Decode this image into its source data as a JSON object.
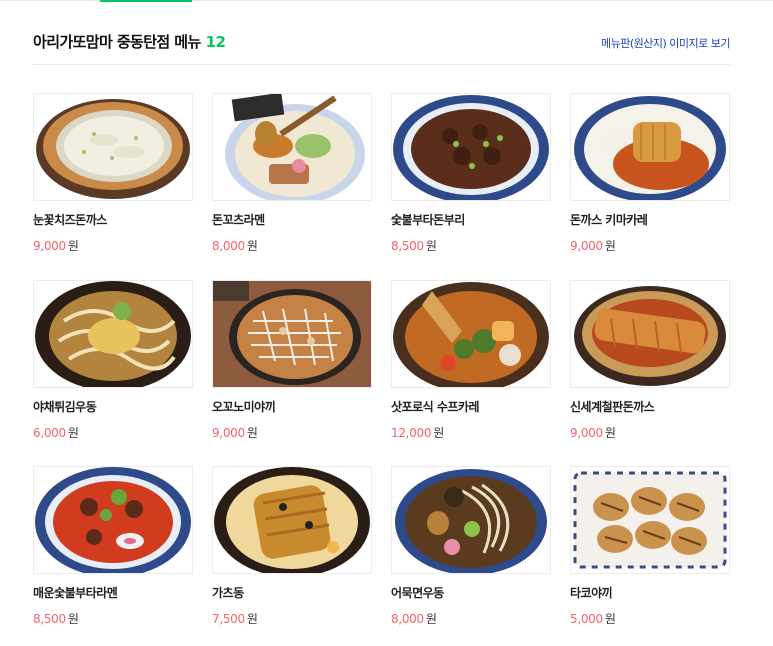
{
  "header": {
    "title": "아리가또맘마 중동탄점 메뉴",
    "count": "12",
    "menu_image_link": "메뉴판(원산지) 이미지로 보기"
  },
  "currency_unit": "원",
  "colors": {
    "accent_green": "#03c75a",
    "price_red": "#f5636b",
    "link_blue": "#1a3fb8"
  },
  "menu": [
    {
      "name": "눈꽃치즈돈까스",
      "price": "9,000",
      "icon": "dish-image"
    },
    {
      "name": "돈꼬츠라멘",
      "price": "8,000",
      "icon": "dish-image"
    },
    {
      "name": "숯불부타돈부리",
      "price": "8,500",
      "icon": "dish-image"
    },
    {
      "name": "돈까스 키마카레",
      "price": "9,000",
      "icon": "dish-image"
    },
    {
      "name": "야채튀김우동",
      "price": "6,000",
      "icon": "dish-image"
    },
    {
      "name": "오꼬노미야끼",
      "price": "9,000",
      "icon": "dish-image"
    },
    {
      "name": "삿포로식 수프카레",
      "price": "12,000",
      "icon": "dish-image"
    },
    {
      "name": "신세계철판돈까스",
      "price": "9,000",
      "icon": "dish-image"
    },
    {
      "name": "매운숯불부타라멘",
      "price": "8,500",
      "icon": "dish-image"
    },
    {
      "name": "가츠동",
      "price": "7,500",
      "icon": "dish-image"
    },
    {
      "name": "어묵면우동",
      "price": "8,000",
      "icon": "dish-image"
    },
    {
      "name": "타코야끼",
      "price": "5,000",
      "icon": "dish-image"
    }
  ]
}
